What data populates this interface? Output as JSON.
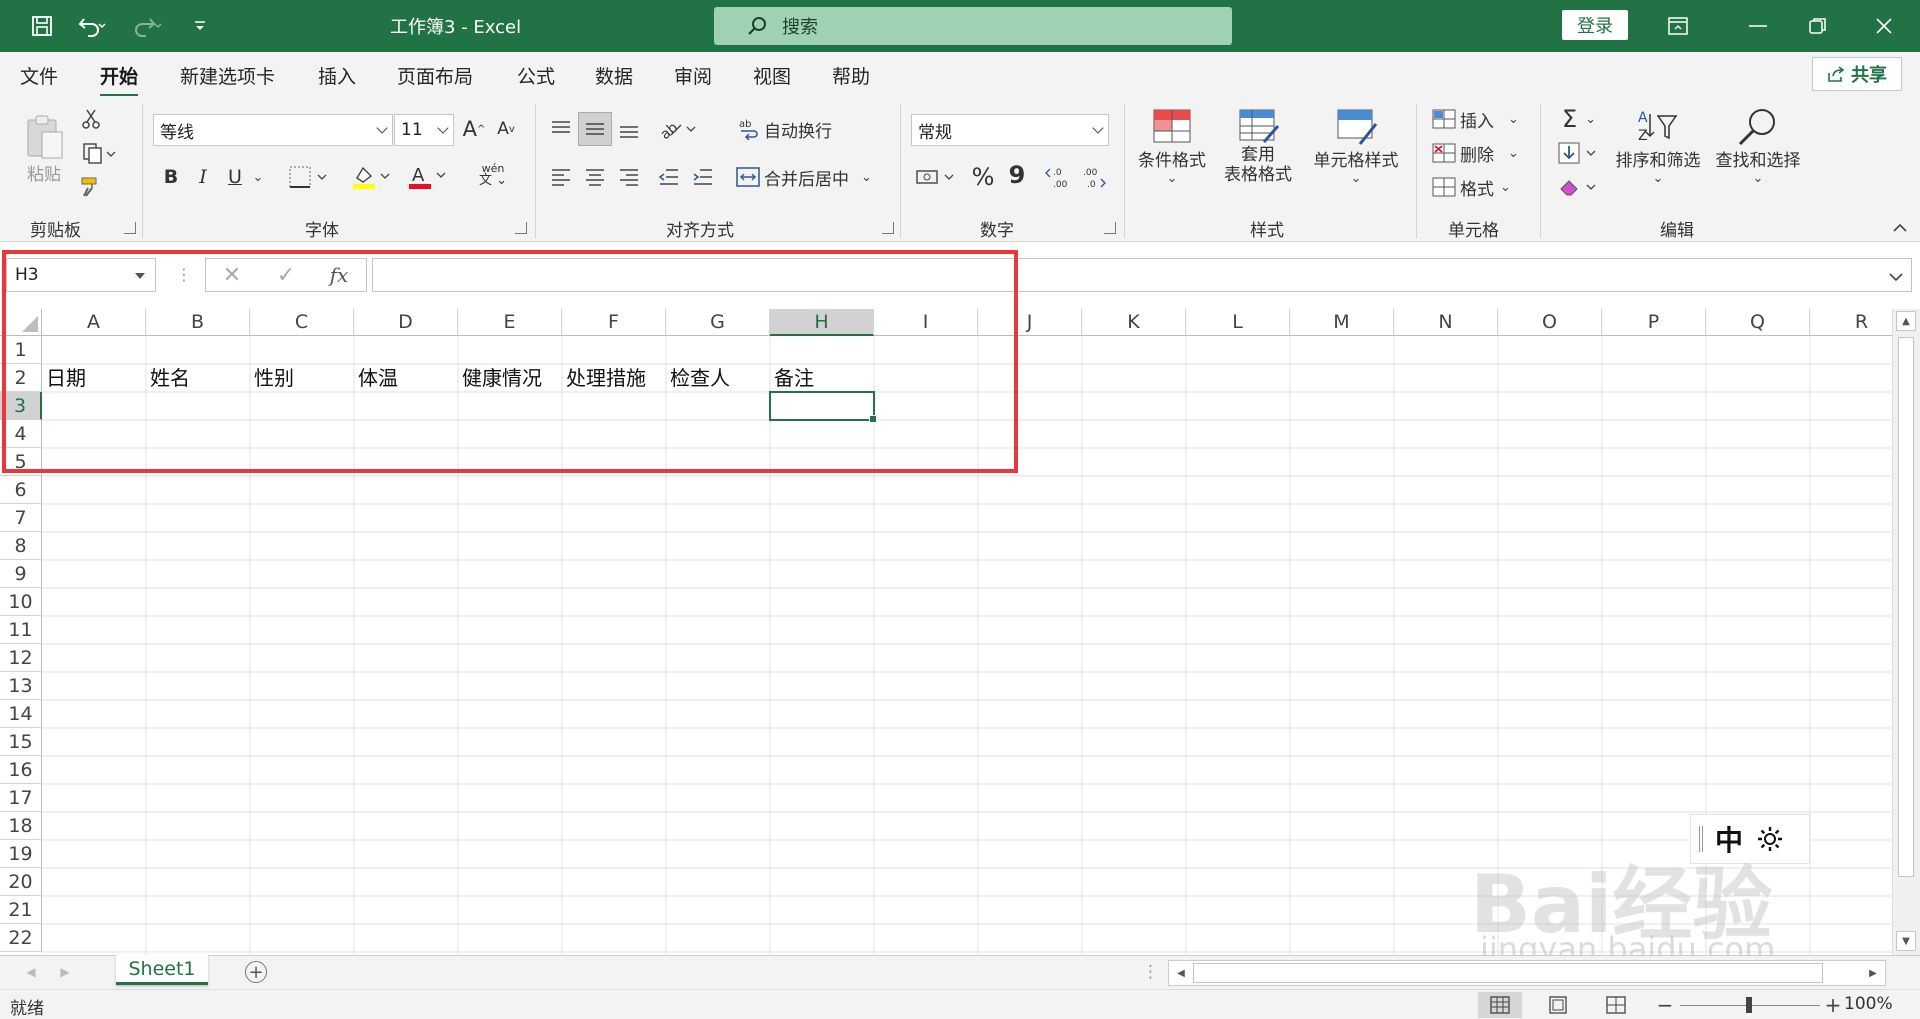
{
  "window": {
    "title": "工作簿3  -  Excel",
    "search_placeholder": "搜索",
    "login_label": "登录"
  },
  "tabs": [
    {
      "label": "文件",
      "active": false
    },
    {
      "label": "开始",
      "active": true
    },
    {
      "label": "新建选项卡",
      "active": false
    },
    {
      "label": "插入",
      "active": false
    },
    {
      "label": "页面布局",
      "active": false
    },
    {
      "label": "公式",
      "active": false
    },
    {
      "label": "数据",
      "active": false
    },
    {
      "label": "审阅",
      "active": false
    },
    {
      "label": "视图",
      "active": false
    },
    {
      "label": "帮助",
      "active": false
    }
  ],
  "share_label": "共享",
  "ribbon": {
    "clipboard": {
      "paste_label": "粘贴",
      "group_label": "剪贴板"
    },
    "font": {
      "font_name": "等线",
      "font_size": "11",
      "bold": "B",
      "italic": "I",
      "underline": "U",
      "font_color_glyph": "A",
      "phonetic_glyph": "wén",
      "grow_glyph": "A",
      "shrink_glyph": "A",
      "group_label": "字体"
    },
    "alignment": {
      "wrap_label": "自动换行",
      "merge_label": "合并后居中",
      "group_label": "对齐方式"
    },
    "number": {
      "format_value": "常规",
      "percent_glyph": "%",
      "comma_glyph": "9",
      "group_label": "数字"
    },
    "styles": {
      "conditional_label": "条件格式",
      "table_label_1": "套用",
      "table_label_2": "表格格式",
      "cell_styles_label": "单元格样式",
      "group_label": "样式"
    },
    "cells": {
      "insert_label": "插入",
      "delete_label": "删除",
      "format_label": "格式",
      "group_label": "单元格"
    },
    "editing": {
      "sort_label": "排序和筛选",
      "find_label": "查找和选择",
      "group_label": "编辑"
    }
  },
  "formula_bar": {
    "name_box": "H3",
    "formula": ""
  },
  "grid": {
    "columns": [
      "A",
      "B",
      "C",
      "D",
      "E",
      "F",
      "G",
      "H",
      "I",
      "J",
      "K",
      "L",
      "M",
      "N",
      "O",
      "P",
      "Q",
      "R"
    ],
    "rows": [
      "1",
      "2",
      "3",
      "4",
      "5",
      "6",
      "7",
      "8",
      "9",
      "10",
      "11",
      "12",
      "13",
      "14",
      "15",
      "16",
      "17",
      "18",
      "19",
      "20",
      "21",
      "22"
    ],
    "selected_cell": "H3",
    "row2_values": [
      "日期",
      "姓名",
      "性别",
      "体温",
      "健康情况",
      "处理措施",
      "检查人",
      "备注"
    ]
  },
  "sheet_tabs": [
    {
      "label": "Sheet1",
      "active": true
    }
  ],
  "status": {
    "ready": "就绪",
    "zoom": "100%"
  },
  "ime": {
    "mode": "中"
  },
  "watermark": {
    "brand": "Bai经验",
    "url": "jingyan.baidu.com"
  },
  "colors": {
    "accent": "#217346",
    "highlight_box": "#e8383d"
  }
}
